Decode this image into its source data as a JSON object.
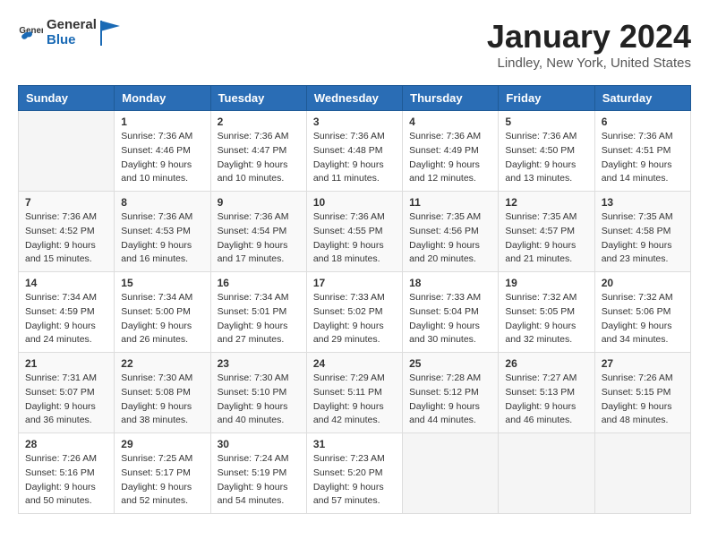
{
  "header": {
    "logo_general": "General",
    "logo_blue": "Blue",
    "title": "January 2024",
    "location": "Lindley, New York, United States"
  },
  "weekdays": [
    "Sunday",
    "Monday",
    "Tuesday",
    "Wednesday",
    "Thursday",
    "Friday",
    "Saturday"
  ],
  "weeks": [
    [
      {
        "day": "",
        "info": ""
      },
      {
        "day": "1",
        "info": "Sunrise: 7:36 AM\nSunset: 4:46 PM\nDaylight: 9 hours\nand 10 minutes."
      },
      {
        "day": "2",
        "info": "Sunrise: 7:36 AM\nSunset: 4:47 PM\nDaylight: 9 hours\nand 10 minutes."
      },
      {
        "day": "3",
        "info": "Sunrise: 7:36 AM\nSunset: 4:48 PM\nDaylight: 9 hours\nand 11 minutes."
      },
      {
        "day": "4",
        "info": "Sunrise: 7:36 AM\nSunset: 4:49 PM\nDaylight: 9 hours\nand 12 minutes."
      },
      {
        "day": "5",
        "info": "Sunrise: 7:36 AM\nSunset: 4:50 PM\nDaylight: 9 hours\nand 13 minutes."
      },
      {
        "day": "6",
        "info": "Sunrise: 7:36 AM\nSunset: 4:51 PM\nDaylight: 9 hours\nand 14 minutes."
      }
    ],
    [
      {
        "day": "7",
        "info": "Sunrise: 7:36 AM\nSunset: 4:52 PM\nDaylight: 9 hours\nand 15 minutes."
      },
      {
        "day": "8",
        "info": "Sunrise: 7:36 AM\nSunset: 4:53 PM\nDaylight: 9 hours\nand 16 minutes."
      },
      {
        "day": "9",
        "info": "Sunrise: 7:36 AM\nSunset: 4:54 PM\nDaylight: 9 hours\nand 17 minutes."
      },
      {
        "day": "10",
        "info": "Sunrise: 7:36 AM\nSunset: 4:55 PM\nDaylight: 9 hours\nand 18 minutes."
      },
      {
        "day": "11",
        "info": "Sunrise: 7:35 AM\nSunset: 4:56 PM\nDaylight: 9 hours\nand 20 minutes."
      },
      {
        "day": "12",
        "info": "Sunrise: 7:35 AM\nSunset: 4:57 PM\nDaylight: 9 hours\nand 21 minutes."
      },
      {
        "day": "13",
        "info": "Sunrise: 7:35 AM\nSunset: 4:58 PM\nDaylight: 9 hours\nand 23 minutes."
      }
    ],
    [
      {
        "day": "14",
        "info": "Sunrise: 7:34 AM\nSunset: 4:59 PM\nDaylight: 9 hours\nand 24 minutes."
      },
      {
        "day": "15",
        "info": "Sunrise: 7:34 AM\nSunset: 5:00 PM\nDaylight: 9 hours\nand 26 minutes."
      },
      {
        "day": "16",
        "info": "Sunrise: 7:34 AM\nSunset: 5:01 PM\nDaylight: 9 hours\nand 27 minutes."
      },
      {
        "day": "17",
        "info": "Sunrise: 7:33 AM\nSunset: 5:02 PM\nDaylight: 9 hours\nand 29 minutes."
      },
      {
        "day": "18",
        "info": "Sunrise: 7:33 AM\nSunset: 5:04 PM\nDaylight: 9 hours\nand 30 minutes."
      },
      {
        "day": "19",
        "info": "Sunrise: 7:32 AM\nSunset: 5:05 PM\nDaylight: 9 hours\nand 32 minutes."
      },
      {
        "day": "20",
        "info": "Sunrise: 7:32 AM\nSunset: 5:06 PM\nDaylight: 9 hours\nand 34 minutes."
      }
    ],
    [
      {
        "day": "21",
        "info": "Sunrise: 7:31 AM\nSunset: 5:07 PM\nDaylight: 9 hours\nand 36 minutes."
      },
      {
        "day": "22",
        "info": "Sunrise: 7:30 AM\nSunset: 5:08 PM\nDaylight: 9 hours\nand 38 minutes."
      },
      {
        "day": "23",
        "info": "Sunrise: 7:30 AM\nSunset: 5:10 PM\nDaylight: 9 hours\nand 40 minutes."
      },
      {
        "day": "24",
        "info": "Sunrise: 7:29 AM\nSunset: 5:11 PM\nDaylight: 9 hours\nand 42 minutes."
      },
      {
        "day": "25",
        "info": "Sunrise: 7:28 AM\nSunset: 5:12 PM\nDaylight: 9 hours\nand 44 minutes."
      },
      {
        "day": "26",
        "info": "Sunrise: 7:27 AM\nSunset: 5:13 PM\nDaylight: 9 hours\nand 46 minutes."
      },
      {
        "day": "27",
        "info": "Sunrise: 7:26 AM\nSunset: 5:15 PM\nDaylight: 9 hours\nand 48 minutes."
      }
    ],
    [
      {
        "day": "28",
        "info": "Sunrise: 7:26 AM\nSunset: 5:16 PM\nDaylight: 9 hours\nand 50 minutes."
      },
      {
        "day": "29",
        "info": "Sunrise: 7:25 AM\nSunset: 5:17 PM\nDaylight: 9 hours\nand 52 minutes."
      },
      {
        "day": "30",
        "info": "Sunrise: 7:24 AM\nSunset: 5:19 PM\nDaylight: 9 hours\nand 54 minutes."
      },
      {
        "day": "31",
        "info": "Sunrise: 7:23 AM\nSunset: 5:20 PM\nDaylight: 9 hours\nand 57 minutes."
      },
      {
        "day": "",
        "info": ""
      },
      {
        "day": "",
        "info": ""
      },
      {
        "day": "",
        "info": ""
      }
    ]
  ]
}
